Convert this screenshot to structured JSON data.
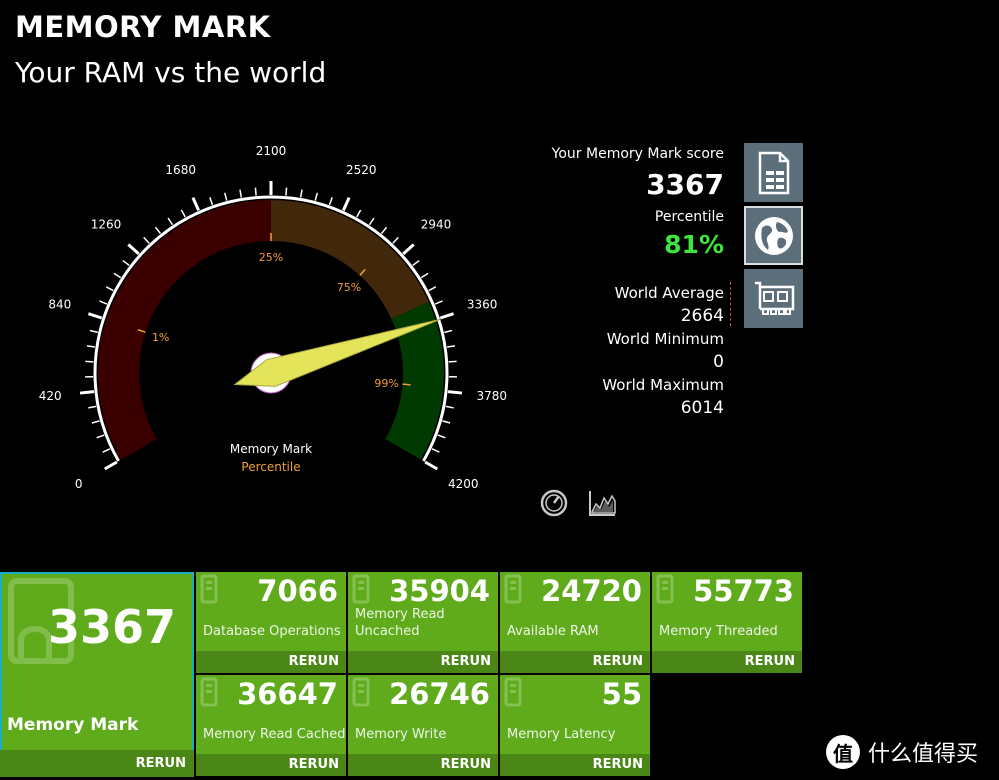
{
  "header": {
    "title": "MEMORY MARK",
    "subtitle": "Your RAM vs the world"
  },
  "gauge": {
    "min": 0,
    "max": 4200,
    "value": 3367,
    "tick_labels": [
      "0",
      "420",
      "840",
      "1260",
      "1680",
      "2100",
      "2520",
      "2940",
      "3360",
      "3780",
      "4200"
    ],
    "percentile_markers": [
      {
        "label": "1%",
        "value": 840
      },
      {
        "label": "25%",
        "value": 2100
      },
      {
        "label": "75%",
        "value": 2840
      },
      {
        "label": "99%",
        "value": 3760
      }
    ],
    "zones": [
      {
        "from": 0,
        "to": 2100,
        "color": "#3a0000"
      },
      {
        "from": 2100,
        "to": 3250,
        "color": "#42280a"
      },
      {
        "from": 3250,
        "to": 4200,
        "color": "#003a00"
      }
    ],
    "center_label": "Memory Mark",
    "center_sublabel": "Percentile"
  },
  "score_panel": {
    "score_label": "Your Memory Mark score",
    "score": "3367",
    "percentile_label": "Percentile",
    "percentile": "81%",
    "world_average_label": "World Average",
    "world_average": "2664",
    "world_minimum_label": "World Minimum",
    "world_minimum": "0",
    "world_maximum_label": "World Maximum",
    "world_maximum": "6014"
  },
  "side_icons": [
    "document-list-icon",
    "globe-icon",
    "ram-module-icon"
  ],
  "view_icons": [
    "gauge-view-icon",
    "chart-view-icon"
  ],
  "tiles": {
    "main": {
      "value": "3367",
      "label": "Memory Mark",
      "rerun": "RERUN"
    },
    "items": [
      {
        "value": "7066",
        "label": "Database Operations",
        "rerun": "RERUN"
      },
      {
        "value": "35904",
        "label": "Memory Read Uncached",
        "rerun": "RERUN"
      },
      {
        "value": "24720",
        "label": "Available RAM",
        "rerun": "RERUN"
      },
      {
        "value": "55773",
        "label": "Memory Threaded",
        "rerun": "RERUN"
      },
      {
        "value": "36647",
        "label": "Memory Read Cached",
        "rerun": "RERUN"
      },
      {
        "value": "26746",
        "label": "Memory Write",
        "rerun": "RERUN"
      },
      {
        "value": "55",
        "label": "Memory Latency",
        "rerun": "RERUN"
      }
    ]
  },
  "watermark": {
    "logo": "值",
    "text": "什么值得买"
  },
  "colors": {
    "tile": "#5fab1c",
    "tile_dark": "#4a8717",
    "accent_green": "#3ce63c",
    "selected_border": "#18b0c0",
    "needle": "#e4e45a"
  }
}
